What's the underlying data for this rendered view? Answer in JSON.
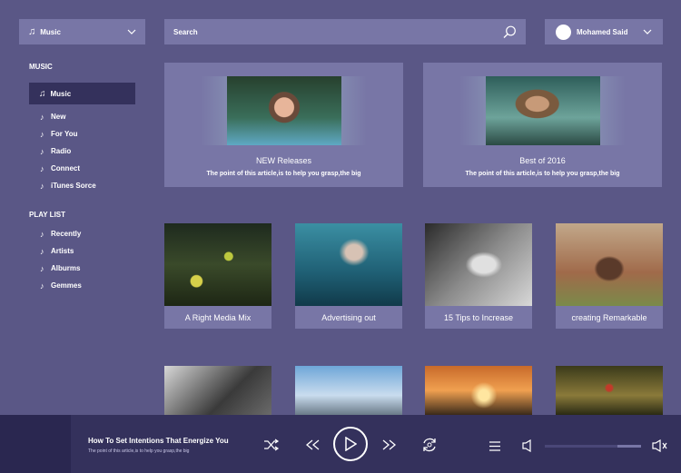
{
  "header": {
    "music_select": "Music",
    "search_placeholder": "Search",
    "user_name": "Mohamed Said"
  },
  "sidebar": {
    "music_heading": "MUSIC",
    "active_item": "Music",
    "music_items": [
      "New",
      "For You",
      "Radio",
      "Connect",
      "iTunes Sorce"
    ],
    "playlist_heading": "PLAY LIST",
    "playlist_items": [
      "Recently",
      "Artists",
      "Alburms",
      "Gemmes"
    ]
  },
  "features": [
    {
      "title": "NEW Releases",
      "subtitle": "The point of this article,is to help you grasp,the big"
    },
    {
      "title": "Best of 2016",
      "subtitle": "The point of this article,is to help you grasp,the big"
    }
  ],
  "albums": [
    {
      "caption": "A Right Media Mix"
    },
    {
      "caption": "Advertising out"
    },
    {
      "caption": "15 Tips to Increase"
    },
    {
      "caption": "creating Remarkable"
    }
  ],
  "player": {
    "title": "How To Set Intentions That Energize You",
    "subtitle": "The point of this article,is to help you grasp,the big",
    "progress": 0.75
  },
  "colors": {
    "background": "#5a5786",
    "panel": "#7876a6",
    "dark": "#34315c"
  },
  "icons": [
    "music-note-icon",
    "chevron-down-icon",
    "search-icon",
    "shuffle-icon",
    "rewind-icon",
    "play-icon",
    "fast-forward-icon",
    "repeat-icon",
    "menu-icon",
    "volume-low-icon",
    "volume-high-icon"
  ]
}
